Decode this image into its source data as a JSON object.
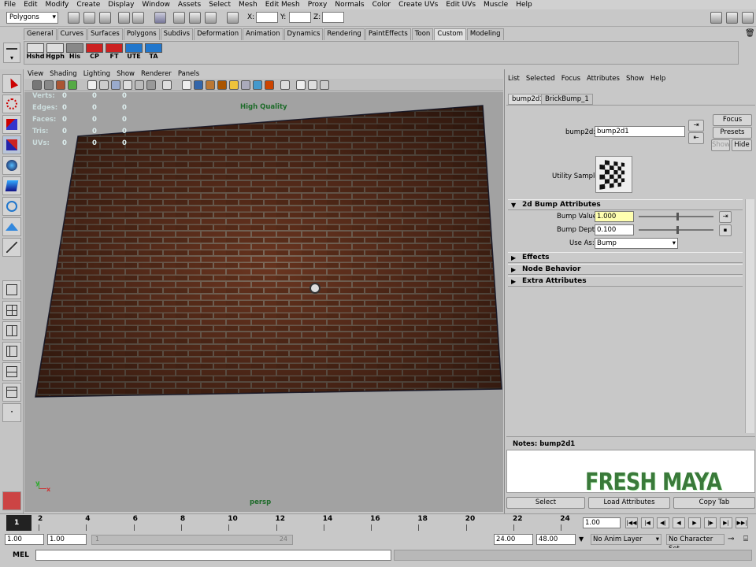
{
  "menu": [
    "File",
    "Edit",
    "Modify",
    "Create",
    "Display",
    "Window",
    "Assets",
    "Select",
    "Mesh",
    "Edit Mesh",
    "Proxy",
    "Normals",
    "Color",
    "Create UVs",
    "Edit UVs",
    "Muscle",
    "Help"
  ],
  "status": {
    "mode": "Polygons",
    "x_label": "X:",
    "y_label": "Y:",
    "z_label": "Z:"
  },
  "shelf_tabs": [
    "General",
    "Curves",
    "Surfaces",
    "Polygons",
    "Subdivs",
    "Deformation",
    "Animation",
    "Dynamics",
    "Rendering",
    "PaintEffects",
    "Toon",
    "Custom",
    "Modeling"
  ],
  "shelf_active": "Custom",
  "shelf_buttons": [
    "Hshd",
    "Hgph",
    "His",
    "CP",
    "FT",
    "UTE",
    "TA"
  ],
  "view_menu": [
    "View",
    "Shading",
    "Lighting",
    "Show",
    "Renderer",
    "Panels"
  ],
  "hud": {
    "rows": [
      {
        "label": "Verts:",
        "a": "0",
        "b": "0",
        "c": "0"
      },
      {
        "label": "Edges:",
        "a": "0",
        "b": "0",
        "c": "0"
      },
      {
        "label": "Faces:",
        "a": "0",
        "b": "0",
        "c": "0"
      },
      {
        "label": "Tris:",
        "a": "0",
        "b": "0",
        "c": "0"
      },
      {
        "label": "UVs:",
        "a": "0",
        "b": "0",
        "c": "0"
      }
    ],
    "quality": "High Quality",
    "camera": "persp",
    "axis_y": "y",
    "axis_x": "x"
  },
  "attr_editor": {
    "menu": [
      "List",
      "Selected",
      "Focus",
      "Attributes",
      "Show",
      "Help"
    ],
    "tabs": [
      "bump2d1",
      "BrickBump_1"
    ],
    "node_label": "bump2d:",
    "node_value": "bump2d1",
    "focus": "Focus",
    "presets": "Presets",
    "show": "Show",
    "hide": "Hide",
    "utility_sample": "Utility Sample",
    "sections": {
      "bump": "2d Bump Attributes",
      "effects": "Effects",
      "node_behavior": "Node Behavior",
      "extra": "Extra Attributes"
    },
    "bump_value_label": "Bump Value",
    "bump_value": "1.000",
    "bump_value_level": 0.5,
    "bump_depth_label": "Bump Depth",
    "bump_depth": "0.100",
    "bump_depth_level": 0.5,
    "use_as_label": "Use As:",
    "use_as": "Bump",
    "notes_label": "Notes:  bump2d1",
    "select": "Select",
    "load_attributes": "Load Attributes",
    "copy_tab": "Copy Tab"
  },
  "watermark": "FRESH MAYA",
  "timeline": {
    "ticks": [
      "2",
      "4",
      "6",
      "8",
      "10",
      "12",
      "14",
      "16",
      "18",
      "20",
      "22",
      "24"
    ],
    "current_frame": "1",
    "current_field": "1.00"
  },
  "range": {
    "start": "1.00",
    "start2": "1.00",
    "handle_left": "1",
    "handle_right": "24",
    "end": "24.00",
    "end2": "48.00",
    "anim_layer": "No Anim Layer",
    "char_set": "No Character Set"
  },
  "mel_label": "MEL",
  "colors": {
    "brick": "#5a2e1c",
    "mortar": "#8a7a6a",
    "viewport_bg": "#a2a2a2",
    "hud_quality": "#1e6b2a",
    "watermark": "#3a7a3a"
  }
}
